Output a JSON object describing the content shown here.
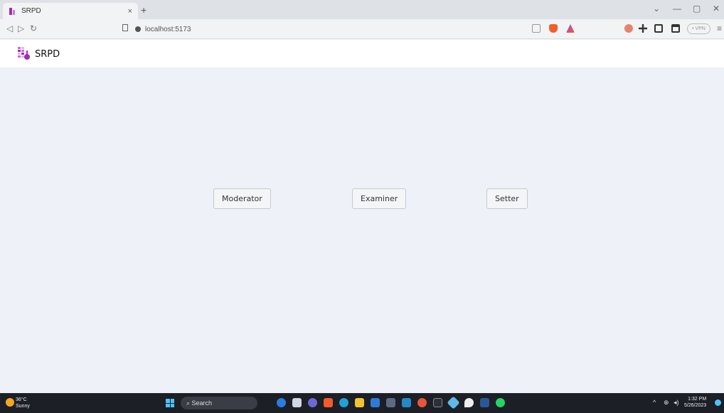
{
  "browser": {
    "tab_title": "SRPD",
    "tab_close": "×",
    "new_tab": "+",
    "url": "localhost:5173",
    "vpn_label": "• VPN",
    "window_controls": [
      "⌄",
      "—",
      "▢",
      "✕"
    ]
  },
  "app": {
    "title": "SRPD",
    "accent": "#9b2fae"
  },
  "roles": {
    "moderator": "Moderator",
    "examiner": "Examiner",
    "setter": "Setter"
  },
  "taskbar": {
    "temperature": "36°C",
    "weather": "Sunny",
    "search": "Search",
    "time": "1:32 PM",
    "date": "5/26/2023"
  }
}
